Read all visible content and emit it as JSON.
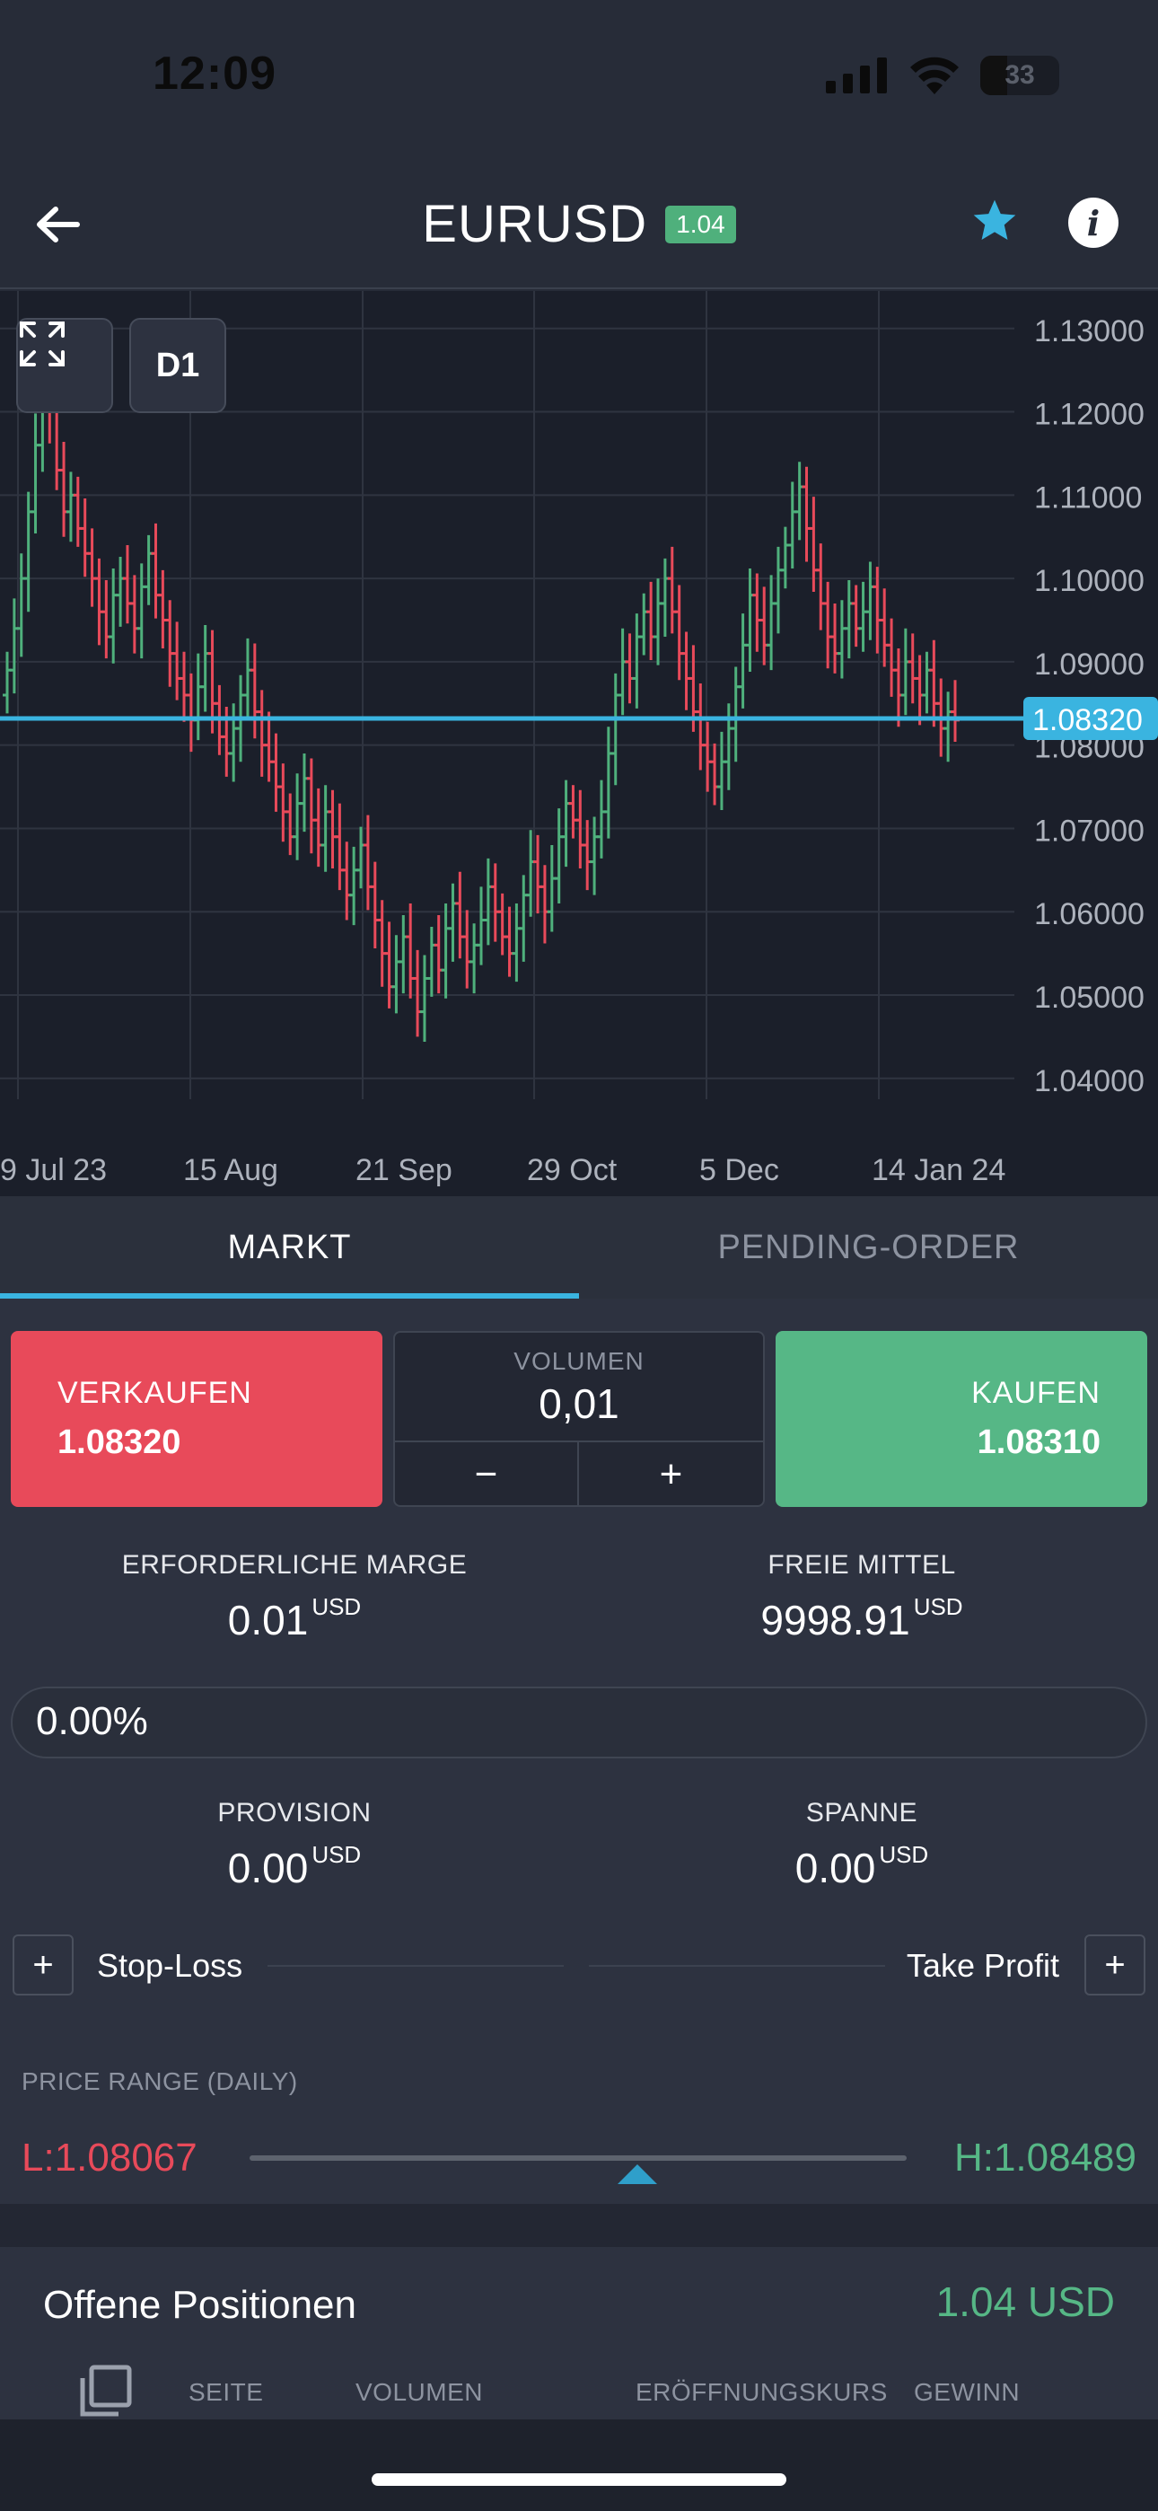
{
  "status_bar": {
    "time": "12:09",
    "battery": "33"
  },
  "header": {
    "title": "EURUSD",
    "badge": "1.04",
    "icons": [
      "back-arrow-icon",
      "star-icon",
      "info-icon"
    ],
    "accent_color": "#3ab4e0"
  },
  "chart": {
    "timeframe": "D1",
    "price_labels": [
      "1.13000",
      "1.12000",
      "1.11000",
      "1.10000",
      "1.09000",
      "1.08000",
      "1.07000",
      "1.06000",
      "1.05000",
      "1.04000"
    ],
    "date_labels": [
      "9 Jul 23",
      "15 Aug",
      "21 Sep",
      "29 Oct",
      "5 Dec",
      "14 Jan 24"
    ],
    "current_price": "1.08320",
    "current_price_value": 1.0832,
    "y_range": [
      1.0375,
      1.1345
    ],
    "closes": [
      1.089,
      1.094,
      1.1,
      1.108,
      1.116,
      1.122,
      1.12,
      1.113,
      1.108,
      1.11,
      1.106,
      1.103,
      1.1,
      1.096,
      1.093,
      1.098,
      1.1,
      1.097,
      1.094,
      1.099,
      1.103,
      1.098,
      1.095,
      1.091,
      1.088,
      1.086,
      1.083,
      1.087,
      1.091,
      1.085,
      1.081,
      1.079,
      1.082,
      1.086,
      1.089,
      1.084,
      1.08,
      1.078,
      1.075,
      1.072,
      1.069,
      1.073,
      1.076,
      1.071,
      1.068,
      1.072,
      1.069,
      1.065,
      1.062,
      1.065,
      1.068,
      1.063,
      1.059,
      1.055,
      1.051,
      1.054,
      1.057,
      1.052,
      1.048,
      1.052,
      1.056,
      1.053,
      1.058,
      1.061,
      1.057,
      1.054,
      1.056,
      1.059,
      1.063,
      1.06,
      1.057,
      1.055,
      1.058,
      1.062,
      1.066,
      1.063,
      1.06,
      1.064,
      1.069,
      1.073,
      1.071,
      1.068,
      1.066,
      1.069,
      1.072,
      1.079,
      1.086,
      1.09,
      1.088,
      1.093,
      1.096,
      1.093,
      1.097,
      1.1,
      1.096,
      1.091,
      1.088,
      1.084,
      1.08,
      1.078,
      1.075,
      1.078,
      1.082,
      1.087,
      1.092,
      1.098,
      1.095,
      1.092,
      1.097,
      1.101,
      1.104,
      1.108,
      1.111,
      1.106,
      1.101,
      1.097,
      1.093,
      1.091,
      1.094,
      1.097,
      1.094,
      1.096,
      1.099,
      1.095,
      1.092,
      1.089,
      1.086,
      1.09,
      1.088,
      1.086,
      1.089,
      1.085,
      1.082,
      1.084,
      1.083
    ]
  },
  "tabs": [
    {
      "label": "MARKT",
      "active": true
    },
    {
      "label": "PENDING-ORDER",
      "active": false
    }
  ],
  "trade": {
    "sell_label": "VERKAUFEN",
    "sell_price": "1.08320",
    "buy_label": "KAUFEN",
    "buy_price": "1.08310",
    "volume_label": "VOLUMEN",
    "volume_value": "0,01",
    "minus_label": "−",
    "plus_label": "+"
  },
  "stats": {
    "margin_label": "ERFORDERLICHE MARGE",
    "margin_value": "0.01",
    "margin_unit": "USD",
    "free_label": "FREIE MITTEL",
    "free_value": "9998.91",
    "free_unit": "USD",
    "percent_value": "0.00%",
    "commission_label": "PROVISION",
    "commission_value": "0.00",
    "commission_unit": "USD",
    "spread_label": "SPANNE",
    "spread_value": "0.00",
    "spread_unit": "USD"
  },
  "orders": {
    "stop_loss_label": "Stop-Loss",
    "take_profit_label": "Take Profit",
    "add_label": "+"
  },
  "price_range": {
    "title": "PRICE RANGE (DAILY)",
    "low": "L:1.08067",
    "high": "H:1.08489",
    "low_color": "#e84a5a",
    "high_color": "#56b786"
  },
  "positions": {
    "title": "Offene Positionen",
    "total": "1.04 USD",
    "columns": [
      "SEITE",
      "VOLUMEN",
      "ERÖFFNUNGSKURS",
      "GEWINN"
    ]
  }
}
